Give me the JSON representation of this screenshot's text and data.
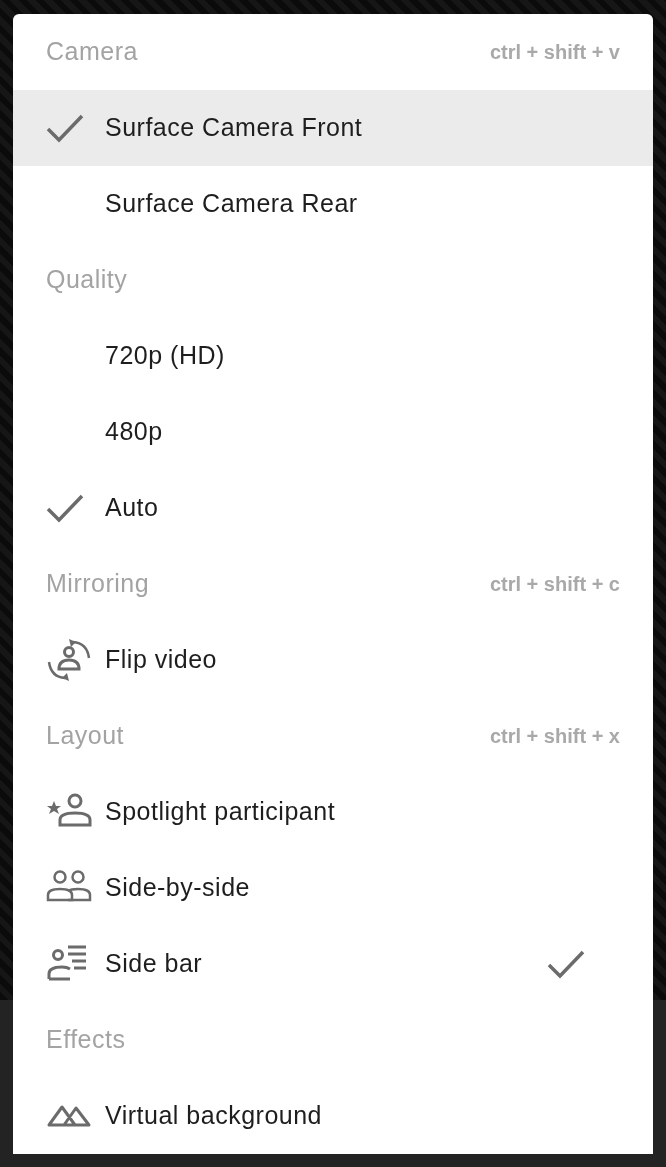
{
  "sections": [
    {
      "title": "Camera",
      "shortcut": "ctrl + shift + v",
      "items": [
        {
          "kind": "option",
          "label": "Surface Camera Front",
          "checked": true,
          "highlighted": true
        },
        {
          "kind": "option",
          "label": "Surface Camera Rear",
          "checked": false,
          "highlighted": false
        }
      ]
    },
    {
      "title": "Quality",
      "items": [
        {
          "kind": "option",
          "label": "720p (HD)",
          "checked": false,
          "highlighted": false
        },
        {
          "kind": "option",
          "label": "480p",
          "checked": false,
          "highlighted": false
        },
        {
          "kind": "option",
          "label": "Auto",
          "checked": true,
          "highlighted": false
        }
      ]
    },
    {
      "title": "Mirroring",
      "shortcut": "ctrl + shift + c",
      "items": [
        {
          "kind": "flip",
          "label": "Flip video",
          "checked": false,
          "highlighted": false
        }
      ]
    },
    {
      "title": "Layout",
      "shortcut": "ctrl + shift + x",
      "items": [
        {
          "kind": "spotlight",
          "label": "Spotlight participant",
          "checked": false,
          "highlighted": false
        },
        {
          "kind": "side-by-side",
          "label": "Side-by-side",
          "checked": false,
          "highlighted": false
        },
        {
          "kind": "side-bar",
          "label": "Side bar",
          "checked": true,
          "highlighted": false
        }
      ]
    },
    {
      "title": "Effects",
      "items": [
        {
          "kind": "background",
          "label": "Virtual background",
          "checked": false,
          "highlighted": false
        }
      ]
    }
  ]
}
